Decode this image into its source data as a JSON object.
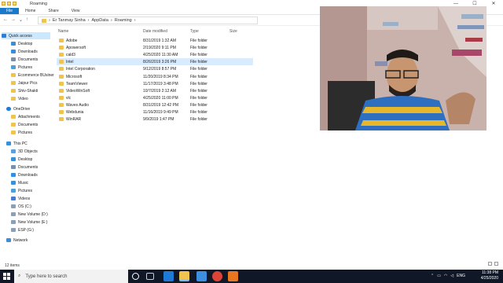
{
  "window": {
    "title": "Roaming",
    "controls": [
      "—",
      "☐",
      "✕"
    ]
  },
  "ribbon": {
    "tabs": [
      "File",
      "Home",
      "Share",
      "View"
    ]
  },
  "address": {
    "path": [
      "Er Tanmay Sinha",
      "AppData",
      "Roaming"
    ]
  },
  "sidebar": {
    "items": [
      {
        "label": "Quick access"
      },
      {
        "label": "Desktop"
      },
      {
        "label": "Downloads"
      },
      {
        "label": "Documents"
      },
      {
        "label": "Pictures"
      },
      {
        "label": "Ecommerce BUsiner"
      },
      {
        "label": "Jaipur Pics"
      },
      {
        "label": "Shiv-Shakti"
      },
      {
        "label": "Video"
      },
      {
        "label": "OneDrive"
      },
      {
        "label": "Attachments"
      },
      {
        "label": "Documents"
      },
      {
        "label": "Pictures"
      },
      {
        "label": "This PC"
      },
      {
        "label": "3D Objects"
      },
      {
        "label": "Desktop"
      },
      {
        "label": "Documents"
      },
      {
        "label": "Downloads"
      },
      {
        "label": "Music"
      },
      {
        "label": "Pictures"
      },
      {
        "label": "Videos"
      },
      {
        "label": "OS (C:)"
      },
      {
        "label": "New Volume (D:)"
      },
      {
        "label": "New Volume (E:)"
      },
      {
        "label": "ESP (G:)"
      },
      {
        "label": "Network"
      }
    ]
  },
  "columns": {
    "name": "Name",
    "date": "Date modified",
    "type": "Type",
    "size": "Size"
  },
  "files": [
    {
      "name": "Adobe",
      "date": "8/31/2019 1:32 AM",
      "type": "File folder"
    },
    {
      "name": "Apowersoft",
      "date": "2/19/2020 9:11 PM",
      "type": "File folder"
    },
    {
      "name": "cald3",
      "date": "4/25/2020 11:30 AM",
      "type": "File folder"
    },
    {
      "name": "Intel",
      "date": "8/26/2019 3:26 PM",
      "type": "File folder"
    },
    {
      "name": "Intel Corporation",
      "date": "9/12/2019 8:57 PM",
      "type": "File folder"
    },
    {
      "name": "Microsoft",
      "date": "11/20/2019 8:34 PM",
      "type": "File folder"
    },
    {
      "name": "TeamViewer",
      "date": "11/17/2019 3:48 PM",
      "type": "File folder"
    },
    {
      "name": "VideoWinSoft",
      "date": "10/7/2019 2:12 AM",
      "type": "File folder"
    },
    {
      "name": "vlc",
      "date": "4/25/2020 11:00 PM",
      "type": "File folder"
    },
    {
      "name": "Waves Audio",
      "date": "8/31/2019 12:42 PM",
      "type": "File folder"
    },
    {
      "name": "Webdunia",
      "date": "11/16/2019 9:49 PM",
      "type": "File folder"
    },
    {
      "name": "WinRAR",
      "date": "9/9/2019 1:47 PM",
      "type": "File folder"
    }
  ],
  "status": {
    "count": "12 items"
  },
  "taskbar": {
    "search_placeholder": "Type here to search",
    "lang": "ENG",
    "time": "11:38 PM",
    "date": "4/25/2020"
  },
  "colors": {
    "accent": "#1979ca",
    "taskbar": "#101828",
    "folder": "#f0c34e"
  }
}
